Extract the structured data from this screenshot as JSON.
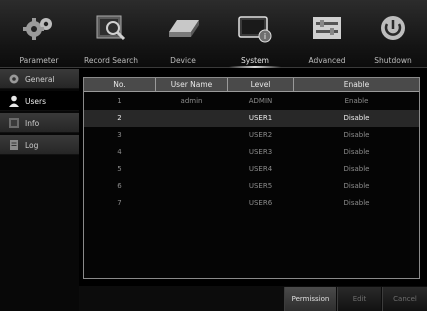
{
  "top_tabs": [
    {
      "label": "Parameter",
      "icon": "gears-icon"
    },
    {
      "label": "Record Search",
      "icon": "record-search-icon"
    },
    {
      "label": "Device",
      "icon": "hard-drive-icon"
    },
    {
      "label": "System",
      "icon": "system-monitor-icon",
      "active": true
    },
    {
      "label": "Advanced",
      "icon": "advanced-settings-icon"
    },
    {
      "label": "Shutdown",
      "icon": "power-icon"
    }
  ],
  "sidebar": {
    "items": [
      {
        "label": "General",
        "icon": "gear-icon"
      },
      {
        "label": "Users",
        "icon": "user-icon",
        "active": true
      },
      {
        "label": "Info",
        "icon": "info-icon"
      },
      {
        "label": "Log",
        "icon": "log-icon"
      }
    ]
  },
  "table": {
    "headers": [
      "No.",
      "User Name",
      "Level",
      "Enable"
    ],
    "rows": [
      {
        "no": "1",
        "user": "admin",
        "level": "ADMIN",
        "enable": "Enable"
      },
      {
        "no": "2",
        "user": "",
        "level": "USER1",
        "enable": "Disable",
        "selected": true
      },
      {
        "no": "3",
        "user": "",
        "level": "USER2",
        "enable": "Disable"
      },
      {
        "no": "4",
        "user": "",
        "level": "USER3",
        "enable": "Disable"
      },
      {
        "no": "5",
        "user": "",
        "level": "USER4",
        "enable": "Disable"
      },
      {
        "no": "6",
        "user": "",
        "level": "USER5",
        "enable": "Disable"
      },
      {
        "no": "7",
        "user": "",
        "level": "USER6",
        "enable": "Disable"
      }
    ]
  },
  "buttons": {
    "permission": "Permission",
    "edit": "Edit",
    "cancel": "Cancel"
  },
  "colors": {
    "background": "#000000",
    "selected_row": "#282828",
    "header_row": "#4a4a4a"
  }
}
